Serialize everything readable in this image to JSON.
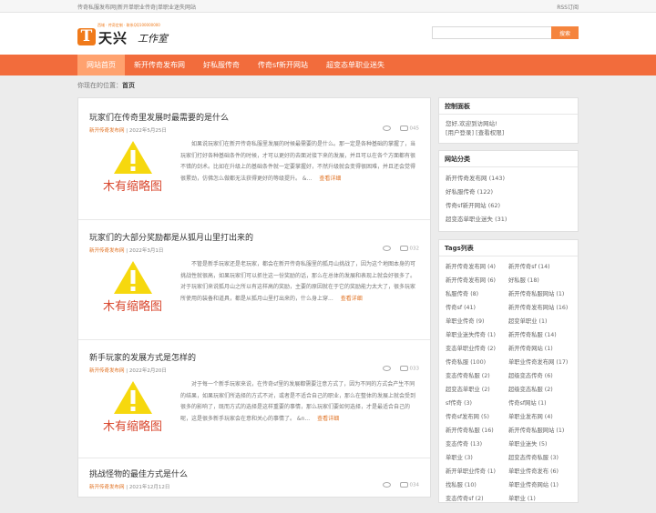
{
  "topbar": {
    "text": "传奇私服发布网|新开单职业传奇|单职业迷失网站",
    "rss": "RSS订阅"
  },
  "logo": {
    "mark": "T",
    "name": "天兴",
    "studio": "工作室",
    "slogan": "西域 · 传奇定制 · 联系QQ100000000"
  },
  "search": {
    "placeholder": "",
    "button": "搜索"
  },
  "nav": [
    "网站首页",
    "新开传奇发布网",
    "好私服传奇",
    "传奇sf新开网站",
    "超变态单职业迷失"
  ],
  "breadcrumb": {
    "prefix": "你现在的位置：",
    "current": "首页"
  },
  "thumb_text": "木有缩略图",
  "posts": [
    {
      "title": "玩家们在传奇里发展时最需要的是什么",
      "category": "新开传奇发布网",
      "date": "2022年5月25日",
      "comments": "045",
      "excerpt": "如果说玩家们在新开传奇私服里发展的时候最需要的是什么。那一定是各种基础的掌握了，当玩家们打好各种基础条件的时候，才可以更好的去面对接下来的发展，并且可以在各个方面都有很不错的剑术。比如在升级上的基础条件就一定要掌握好，不然升级就会变得很困难，并且还会觉得很累劲，仿佛怎么做都无法获得更好的等级提升。 &...",
      "more": "查看详细"
    },
    {
      "title": "玩家们的大部分奖励都是从狐月山里打出来的",
      "category": "新开传奇发布网",
      "date": "2022年3月1日",
      "comments": "032",
      "excerpt": "不管是新手玩家还是老玩家，都会在新开传奇私服里的狐月山挑战了，因为这个地图本身的可挑战性就很高，如果玩家们可以抓住这一份奖励的话，那么在总体的发展和表现上就会好很多了。对于玩家们来说狐月山之所以有这样高的奖励，主要的原因就在于它的奖励能力太大了，很多玩家所使用的装备和道具，都是从狐月山里打出来的，什么身上穿...",
      "more": "查看详细"
    },
    {
      "title": "新手玩家的发展方式是怎样的",
      "category": "新开传奇发布网",
      "date": "2022年2月20日",
      "comments": "033",
      "excerpt": "对于每一个新手玩家来说，在传奇sf里的发展都需要注意方式了，因为不同的方式会产生不同的结果，如果玩家们所选择的方式不对，或者是不适合自己的职业，那么在整体的发展上就会受到很多的影响了，既而方式的选择是这样重要的事情，那么玩家们要如何选择，才是最适合自己的呢，这是很多新手玩家会在意和关心的事情了。 &n...",
      "more": "查看详细"
    },
    {
      "title": "挑战怪物的最佳方式是什么",
      "category": "新开传奇发布网",
      "date": "2021年12月12日",
      "comments": "034",
      "excerpt": "",
      "more": ""
    }
  ],
  "sidebar": {
    "panel": {
      "title": "控制面板",
      "welcome": "您好,欢迎到访网站!",
      "login": "[用户登录]",
      "perm": "[查看权限]"
    },
    "categories": {
      "title": "网站分类",
      "items": [
        "新开传奇发布网 (143)",
        "好私服传奇 (122)",
        "传奇sf新开网站 (62)",
        "超变态单职业迷失 (31)"
      ]
    },
    "tags": {
      "title": "Tags列表",
      "items": [
        "新开传奇发布网 (4)",
        "新开传奇sf (14)",
        "新开传奇发布网 (6)",
        "好私服 (18)",
        "私服传奇 (8)",
        "新开传奇私服网站 (1)",
        "传奇sf (41)",
        "新开传奇发布网站 (16)",
        "单职业传奇 (9)",
        "超变单职业 (1)",
        "单职业迷失传奇 (1)",
        "新开传奇私服 (14)",
        "变态单职业传奇 (2)",
        "新开传奇网站 (1)",
        "传奇私服 (100)",
        "单职业传奇发布网 (17)",
        "变态传奇私服 (2)",
        "超级变态传奇 (6)",
        "超变态单职业 (2)",
        "超级变态私服 (2)",
        "sf传奇 (3)",
        "传奇sf网站 (1)",
        "传奇sf发布网 (5)",
        "单职业发布网 (4)",
        "新开传奇私服 (16)",
        "新开传奇私服网站 (1)",
        "变态传奇 (13)",
        "单职业迷失 (5)",
        "单职业 (3)",
        "超变态传奇私服 (3)",
        "新开单职业传奇 (1)",
        "单职业传奇发布 (6)",
        "找私服 (10)",
        "单职业传奇网站 (1)",
        "变态传奇sf (2)",
        "单职业 (1)"
      ]
    }
  },
  "colors": {
    "accent": "#f26c3c",
    "nav_active": "#ffa26f",
    "link": "#e07020"
  }
}
